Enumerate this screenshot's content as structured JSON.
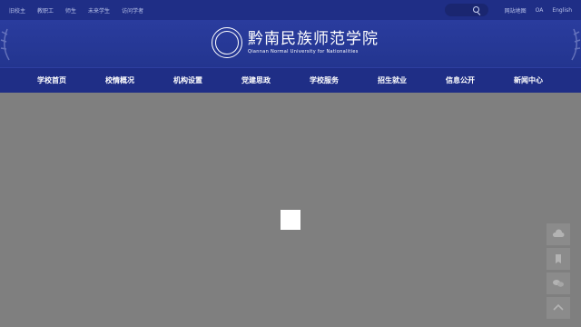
{
  "topbar": {
    "links": [
      "旧校主",
      "教职工",
      "师生",
      "未来学生",
      "访问学者"
    ],
    "right_links": [
      "网站地图",
      "OA",
      "English"
    ]
  },
  "header": {
    "logo_cn": "黔南民族师范学院",
    "logo_en": "Qiannan Normal University for Nationalities"
  },
  "nav": {
    "items": [
      "学校首页",
      "校情概况",
      "机构设置",
      "党建思政",
      "学校服务",
      "招生就业",
      "信息公开",
      "新闻中心"
    ]
  },
  "colors": {
    "topbar": "#1f2e86",
    "header": "#2a3c9e",
    "overlay": "#7f7f7f"
  },
  "side_tools": [
    "cloud-icon",
    "bookmark-icon",
    "chat-icon",
    "top-arrow-icon"
  ]
}
